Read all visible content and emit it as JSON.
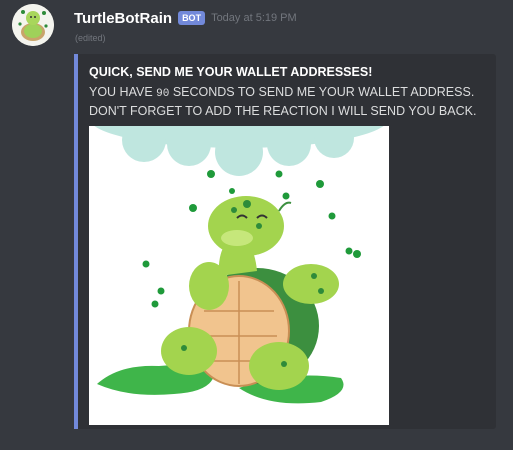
{
  "message": {
    "username": "TurtleBotRain",
    "bot_tag": "BOT",
    "timestamp": "Today at 5:19 PM",
    "edited": "(edited)"
  },
  "embed": {
    "accent_color": "#7289da",
    "title": "QUICK, SEND ME YOUR WALLET ADDRESSES!",
    "description_prefix": "YOU HAVE ",
    "description_code": "90",
    "description_suffix": " SECONDS TO SEND ME YOUR WALLET ADDRESS. DON'T FORGET TO ADD THE REACTION I WILL SEND YOU BACK.",
    "image_icon": "turtle-in-rain-illustration"
  },
  "colors": {
    "background": "#36393f",
    "embed_background": "#2f3136",
    "username": "#ffffff",
    "timestamp": "#72767d"
  }
}
